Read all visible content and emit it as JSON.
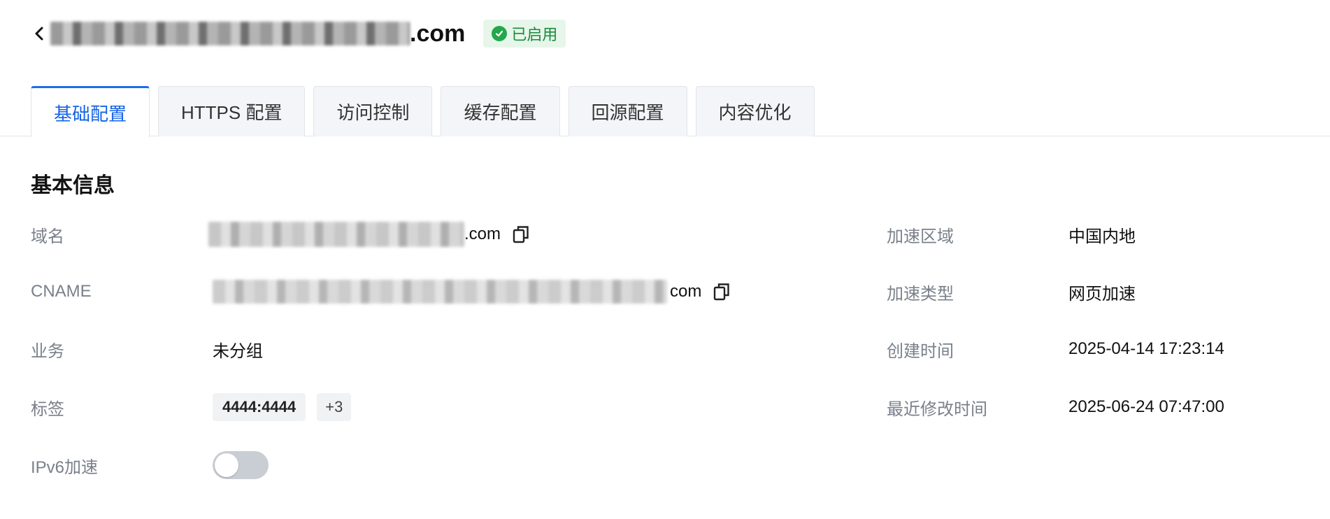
{
  "header": {
    "domain_suffix": ".com",
    "status": "已启用"
  },
  "tabs": [
    {
      "label": "基础配置",
      "active": true
    },
    {
      "label": "HTTPS 配置",
      "active": false
    },
    {
      "label": "访问控制",
      "active": false
    },
    {
      "label": "缓存配置",
      "active": false
    },
    {
      "label": "回源配置",
      "active": false
    },
    {
      "label": "内容优化",
      "active": false
    }
  ],
  "basic_info": {
    "title": "基本信息",
    "domain": {
      "label": "域名",
      "value_suffix": ".com"
    },
    "cname": {
      "label": "CNAME",
      "value_suffix": "com"
    },
    "business": {
      "label": "业务",
      "value": "未分组"
    },
    "tags": {
      "label": "标签",
      "items": [
        "4444:4444"
      ],
      "more": "+3"
    },
    "ipv6": {
      "label": "IPv6加速",
      "enabled": false
    },
    "region": {
      "label": "加速区域",
      "value": "中国内地"
    },
    "type": {
      "label": "加速类型",
      "value": "网页加速"
    },
    "created": {
      "label": "创建时间",
      "value": "2025-04-14 17:23:14"
    },
    "modified": {
      "label": "最近修改时间",
      "value": "2025-06-24 07:47:00"
    }
  },
  "colors": {
    "accent": "#1d6cf0",
    "status_bg": "#e6f6ea",
    "status_fg": "#1b8a3a"
  }
}
